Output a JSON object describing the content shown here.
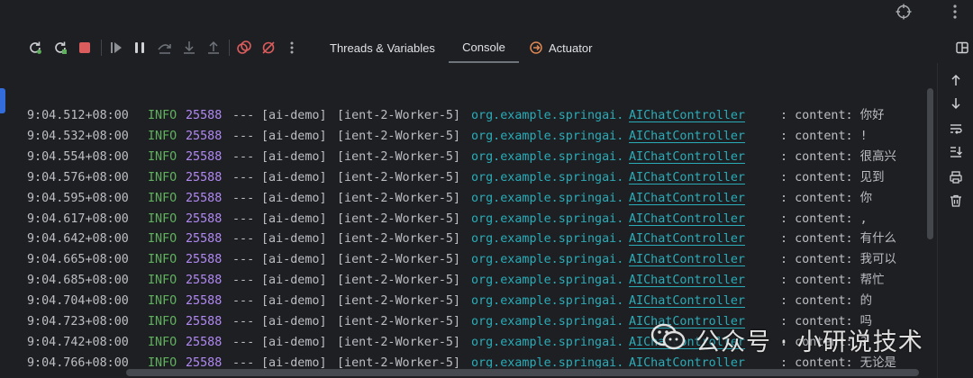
{
  "tabs": [
    {
      "label": "Threads & Variables"
    },
    {
      "label": "Console"
    },
    {
      "label": "Actuator"
    }
  ],
  "toolbar_icons": [
    "rerun-icon",
    "rerun-failed-icon",
    "stop-icon",
    "resume-icon",
    "pause-icon",
    "step-over-icon",
    "step-into-icon",
    "step-out-icon",
    "view-breakpoints-icon",
    "mute-breakpoints-icon",
    "more-icon"
  ],
  "rail_icons": [
    "scroll-up-icon",
    "scroll-down-icon",
    "soft-wrap-icon",
    "scroll-to-end-icon",
    "print-icon",
    "clear-icon"
  ],
  "log_lines": [
    {
      "ts": "9:04.512+08:00",
      "level": "INFO",
      "pid": "25588",
      "dash": "---",
      "app": "[ai-demo]",
      "thread": "[ient-2-Worker-5]",
      "pkg": "org.example.springai.",
      "cls": "AIChatController",
      "msg": ": content: 你好"
    },
    {
      "ts": "9:04.532+08:00",
      "level": "INFO",
      "pid": "25588",
      "dash": "---",
      "app": "[ai-demo]",
      "thread": "[ient-2-Worker-5]",
      "pkg": "org.example.springai.",
      "cls": "AIChatController",
      "msg": ": content: !"
    },
    {
      "ts": "9:04.554+08:00",
      "level": "INFO",
      "pid": "25588",
      "dash": "---",
      "app": "[ai-demo]",
      "thread": "[ient-2-Worker-5]",
      "pkg": "org.example.springai.",
      "cls": "AIChatController",
      "msg": ": content: 很高兴"
    },
    {
      "ts": "9:04.576+08:00",
      "level": "INFO",
      "pid": "25588",
      "dash": "---",
      "app": "[ai-demo]",
      "thread": "[ient-2-Worker-5]",
      "pkg": "org.example.springai.",
      "cls": "AIChatController",
      "msg": ": content: 见到"
    },
    {
      "ts": "9:04.595+08:00",
      "level": "INFO",
      "pid": "25588",
      "dash": "---",
      "app": "[ai-demo]",
      "thread": "[ient-2-Worker-5]",
      "pkg": "org.example.springai.",
      "cls": "AIChatController",
      "msg": ": content: 你"
    },
    {
      "ts": "9:04.617+08:00",
      "level": "INFO",
      "pid": "25588",
      "dash": "---",
      "app": "[ai-demo]",
      "thread": "[ient-2-Worker-5]",
      "pkg": "org.example.springai.",
      "cls": "AIChatController",
      "msg": ": content: ,"
    },
    {
      "ts": "9:04.642+08:00",
      "level": "INFO",
      "pid": "25588",
      "dash": "---",
      "app": "[ai-demo]",
      "thread": "[ient-2-Worker-5]",
      "pkg": "org.example.springai.",
      "cls": "AIChatController",
      "msg": ": content: 有什么"
    },
    {
      "ts": "9:04.665+08:00",
      "level": "INFO",
      "pid": "25588",
      "dash": "---",
      "app": "[ai-demo]",
      "thread": "[ient-2-Worker-5]",
      "pkg": "org.example.springai.",
      "cls": "AIChatController",
      "msg": ": content: 我可以"
    },
    {
      "ts": "9:04.685+08:00",
      "level": "INFO",
      "pid": "25588",
      "dash": "---",
      "app": "[ai-demo]",
      "thread": "[ient-2-Worker-5]",
      "pkg": "org.example.springai.",
      "cls": "AIChatController",
      "msg": ": content: 帮忙"
    },
    {
      "ts": "9:04.704+08:00",
      "level": "INFO",
      "pid": "25588",
      "dash": "---",
      "app": "[ai-demo]",
      "thread": "[ient-2-Worker-5]",
      "pkg": "org.example.springai.",
      "cls": "AIChatController",
      "msg": ": content: 的"
    },
    {
      "ts": "9:04.723+08:00",
      "level": "INFO",
      "pid": "25588",
      "dash": "---",
      "app": "[ai-demo]",
      "thread": "[ient-2-Worker-5]",
      "pkg": "org.example.springai.",
      "cls": "AIChatController",
      "msg": ": content: 吗"
    },
    {
      "ts": "9:04.742+08:00",
      "level": "INFO",
      "pid": "25588",
      "dash": "---",
      "app": "[ai-demo]",
      "thread": "[ient-2-Worker-5]",
      "pkg": "org.example.springai.",
      "cls": "AIChatController",
      "msg": ": content: ?"
    },
    {
      "ts": "9:04.766+08:00",
      "level": "INFO",
      "pid": "25588",
      "dash": "---",
      "app": "[ai-demo]",
      "thread": "[ient-2-Worker-5]",
      "pkg": "org.example.springai.",
      "cls": "AIChatController",
      "msg": ": content: 无论是"
    }
  ],
  "watermark": {
    "text": "公众号 · 小研说技术"
  },
  "colors": {
    "background": "#1e1f22",
    "info": "#5fb15d",
    "pid": "#b189f5",
    "logger": "#2aacb8",
    "text": "#bcbec4"
  }
}
